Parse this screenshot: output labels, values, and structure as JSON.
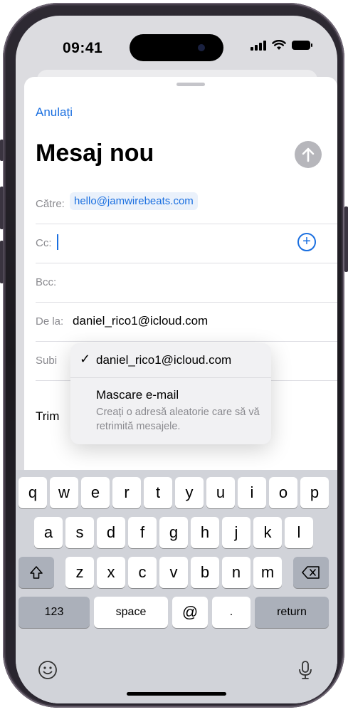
{
  "status_bar": {
    "time": "09:41"
  },
  "sheet": {
    "cancel_label": "Anulați",
    "title": "Mesaj nou"
  },
  "fields": {
    "to_label": "Către:",
    "to_value": "hello@jamwirebeats.com",
    "cc_label": "Cc:",
    "bcc_label": "Bcc:",
    "from_label": "De la:",
    "from_value": "daniel_rico1@icloud.com",
    "subject_label": "Subi",
    "trim_label": "Trim"
  },
  "popup": {
    "items": [
      {
        "label": "daniel_rico1@icloud.com",
        "checked": true
      },
      {
        "label": "Mascare e-mail",
        "subtitle": "Creați o adresă aleatorie care să vă retrimită mesajele."
      }
    ]
  },
  "keyboard": {
    "row1": [
      "q",
      "w",
      "e",
      "r",
      "t",
      "y",
      "u",
      "i",
      "o",
      "p"
    ],
    "row2": [
      "a",
      "s",
      "d",
      "f",
      "g",
      "h",
      "j",
      "k",
      "l"
    ],
    "row3": [
      "z",
      "x",
      "c",
      "v",
      "b",
      "n",
      "m"
    ],
    "numbers_label": "123",
    "space_label": "space",
    "at_label": "@",
    "dot_label": ".",
    "return_label": "return"
  },
  "colors": {
    "accent": "#1a6fe0",
    "keyboard_bg": "#d1d3d9"
  }
}
